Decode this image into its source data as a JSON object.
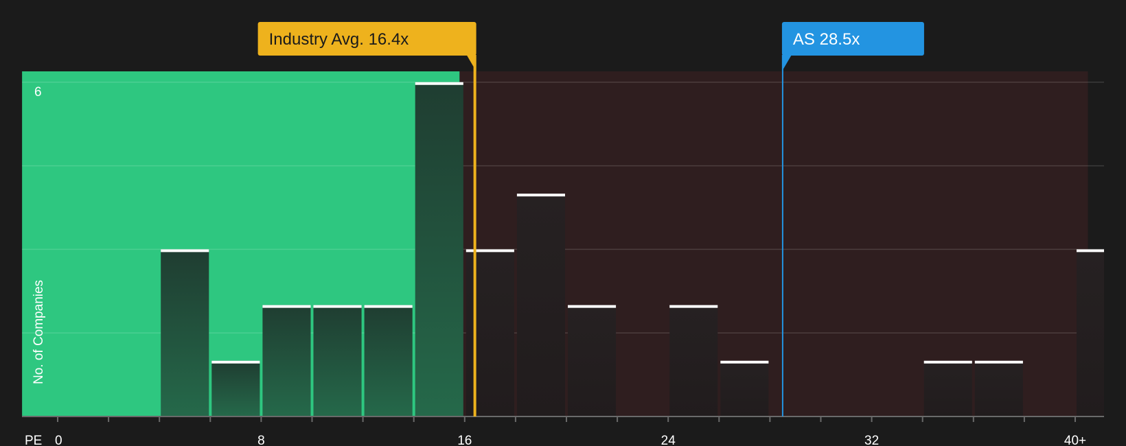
{
  "chart_data": {
    "type": "bar",
    "xlabel": "PE",
    "ylabel": "No. of Companies",
    "x_ticks": [
      "0",
      "8",
      "16",
      "24",
      "32",
      "40+"
    ],
    "y_ticks": [
      "6"
    ],
    "xlim": [
      0,
      40.5
    ],
    "ylim": [
      0,
      6
    ],
    "bin_width": 2,
    "bins": [
      {
        "x0": 4,
        "x1": 6,
        "count": 3
      },
      {
        "x0": 6,
        "x1": 8,
        "count": 1
      },
      {
        "x0": 8,
        "x1": 10,
        "count": 2
      },
      {
        "x0": 10,
        "x1": 12,
        "count": 2
      },
      {
        "x0": 12,
        "x1": 14,
        "count": 2
      },
      {
        "x0": 14,
        "x1": 16,
        "count": 6
      },
      {
        "x0": 16,
        "x1": 18,
        "count": 3
      },
      {
        "x0": 18,
        "x1": 20,
        "count": 4
      },
      {
        "x0": 20,
        "x1": 22,
        "count": 2
      },
      {
        "x0": 24,
        "x1": 26,
        "count": 2
      },
      {
        "x0": 26,
        "x1": 28,
        "count": 1
      },
      {
        "x0": 34,
        "x1": 36,
        "count": 1
      },
      {
        "x0": 36,
        "x1": 38,
        "count": 1
      },
      {
        "x0": 40,
        "x1": 42,
        "count": 3
      }
    ],
    "regions": [
      {
        "name": "below",
        "x0": -1.4,
        "x1": 15.8,
        "color": "#2ec780"
      },
      {
        "name": "above",
        "x0": 15.8,
        "x1": 40.5,
        "color": "#2f1e1f"
      }
    ],
    "markers": [
      {
        "label": "Industry Avg. 16.4x",
        "value": 16.4,
        "color": "#eeb21d"
      },
      {
        "label": "AS 28.5x",
        "value": 28.5,
        "color": "#2394e1"
      }
    ]
  }
}
